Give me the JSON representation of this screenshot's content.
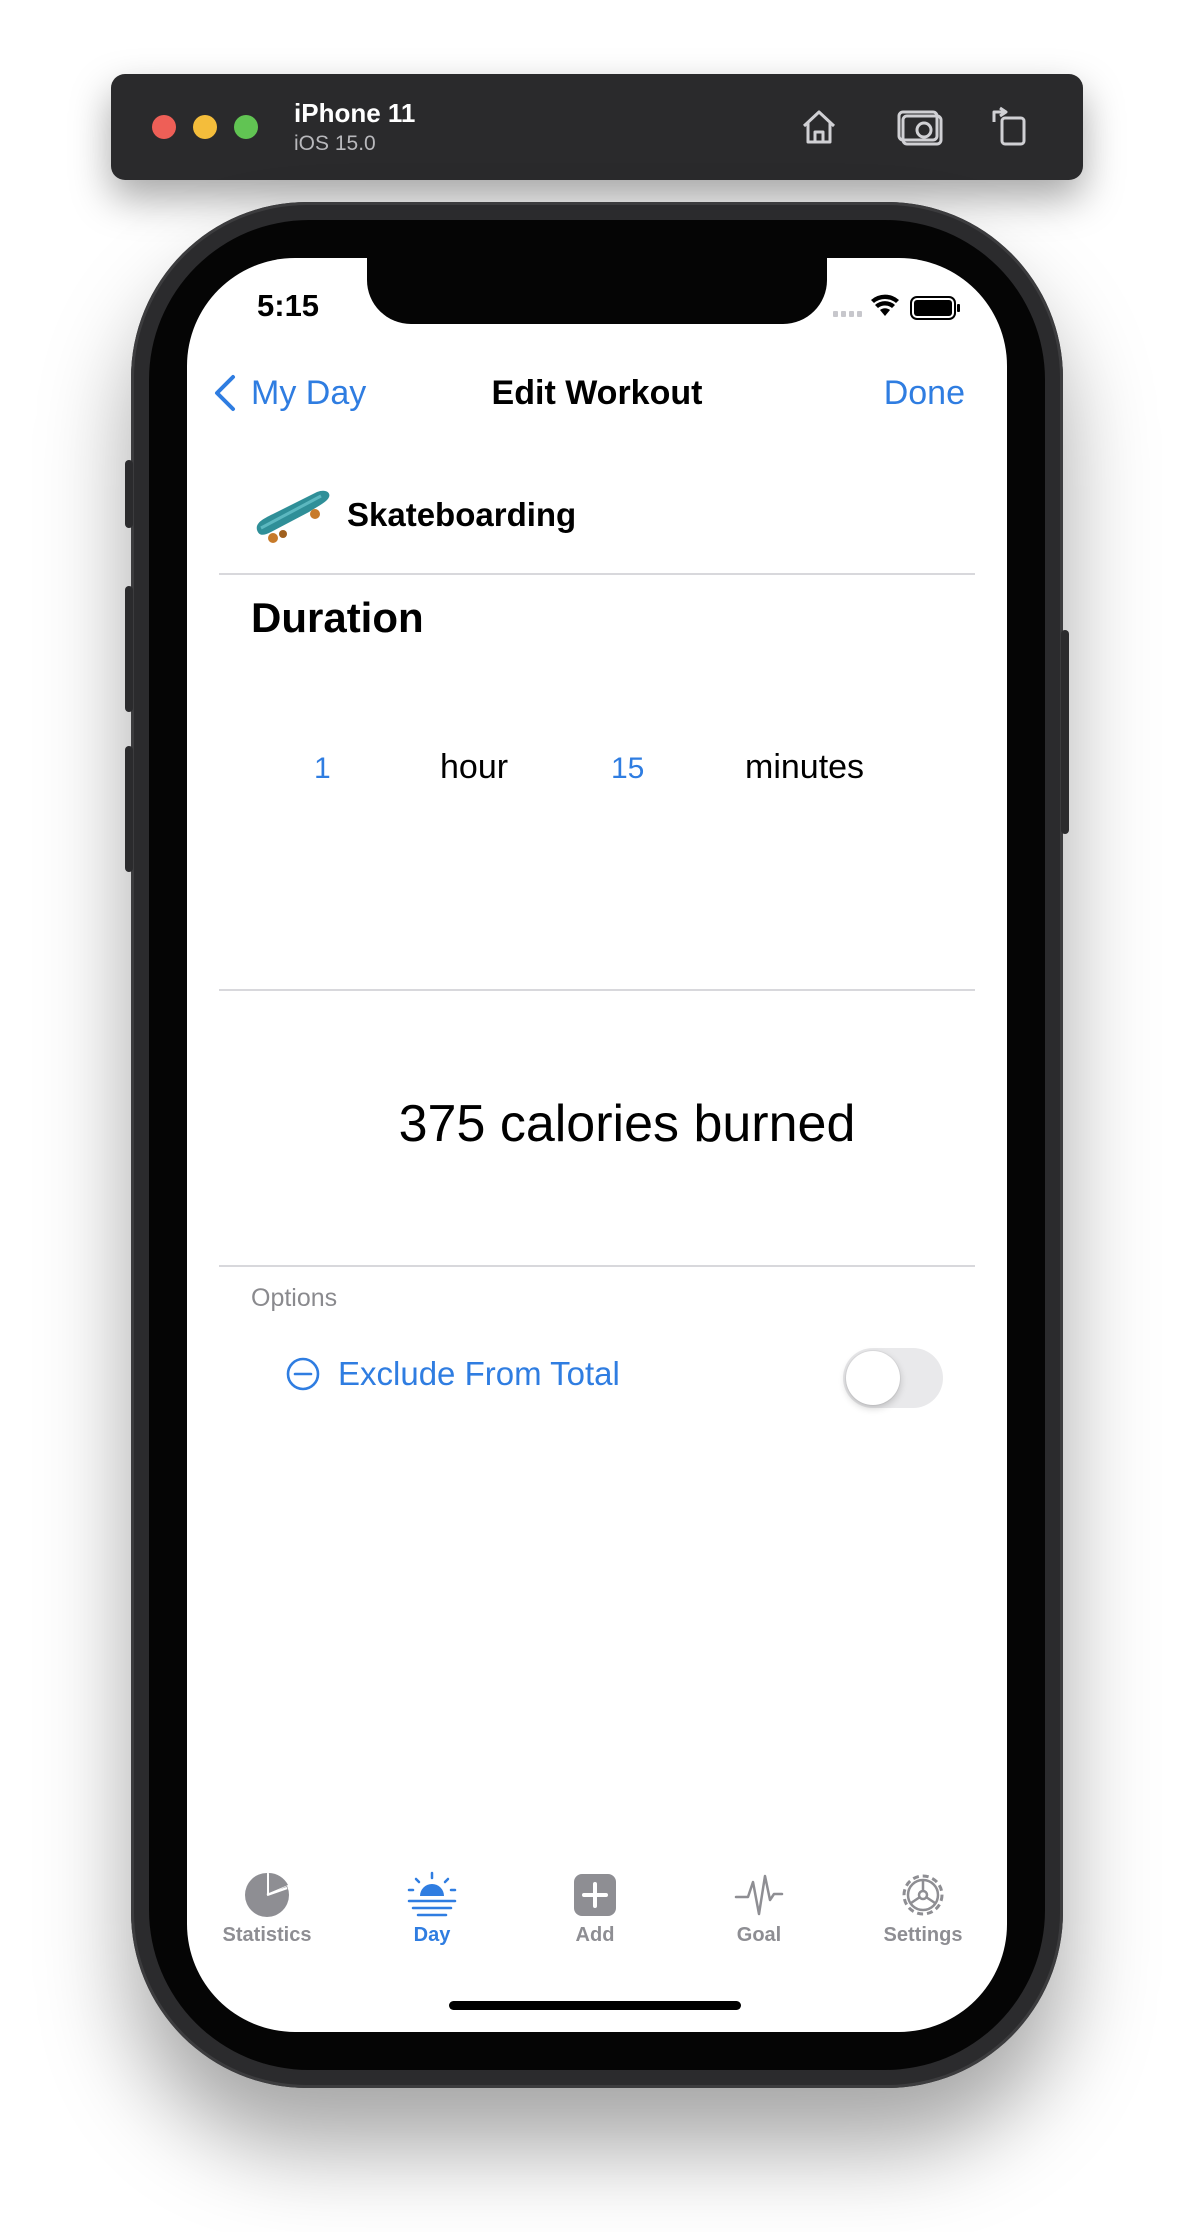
{
  "simulator": {
    "device_name": "iPhone 11",
    "os_version": "iOS 15.0",
    "buttons": [
      "home-icon",
      "screenshot-icon",
      "rotate-icon"
    ]
  },
  "status_bar": {
    "time": "5:15",
    "icons": [
      "signal-icon",
      "wifi-icon",
      "battery-icon"
    ]
  },
  "nav": {
    "back_label": "My Day",
    "title": "Edit Workout",
    "done_label": "Done"
  },
  "activity": {
    "icon": "skateboard-icon",
    "name": "Skateboarding"
  },
  "duration": {
    "title": "Duration",
    "hours_value": "1",
    "hours_unit": "hour",
    "minutes_value": "15",
    "minutes_unit": "minutes"
  },
  "calories_text": "375 calories burned",
  "options": {
    "section_label": "Options",
    "exclude_label": "Exclude From Total",
    "exclude_icon": "minus-circle-icon",
    "exclude_enabled": false
  },
  "tabbar": {
    "tabs": [
      {
        "label": "Statistics",
        "icon": "pie-chart-icon",
        "active": false
      },
      {
        "label": "Day",
        "icon": "sunrise-icon",
        "active": true
      },
      {
        "label": "Add",
        "icon": "plus-square-icon",
        "active": false
      },
      {
        "label": "Goal",
        "icon": "heartbeat-icon",
        "active": false
      },
      {
        "label": "Settings",
        "icon": "gear-icon",
        "active": false
      }
    ]
  },
  "colors": {
    "accent": "#2f7de1",
    "inactive_tab": "#8e8e93",
    "toggle_off": "#e9e9eb"
  }
}
